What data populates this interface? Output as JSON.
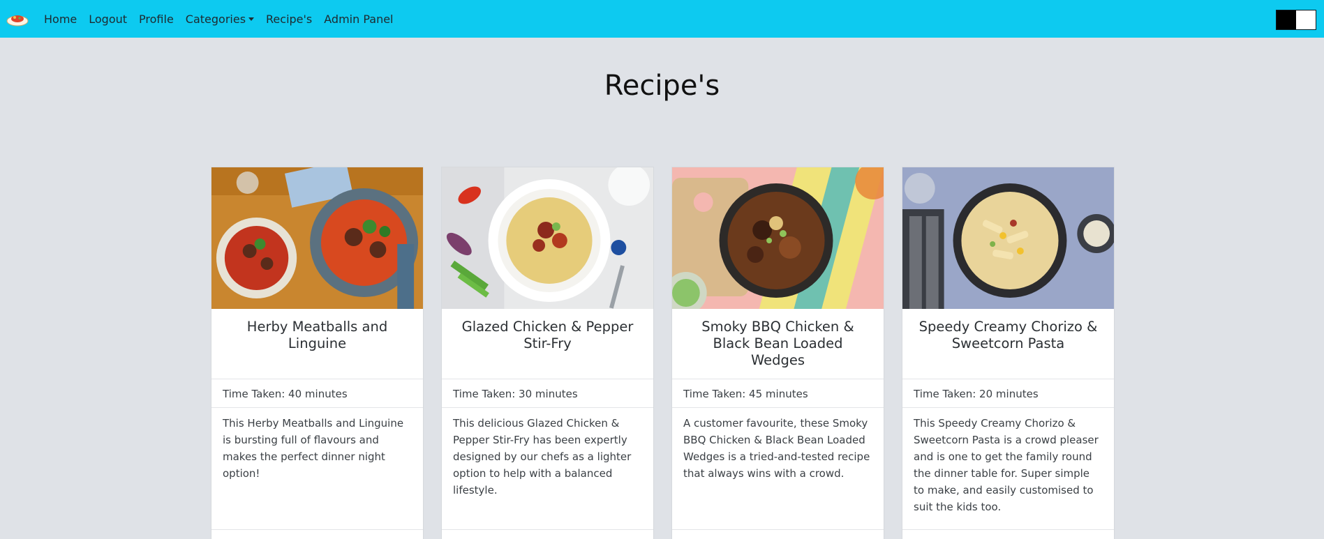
{
  "nav": {
    "brand_icon": "food-bowl-logo-icon",
    "items": [
      {
        "label": "Home"
      },
      {
        "label": "Logout"
      },
      {
        "label": "Profile"
      },
      {
        "label": "Categories"
      },
      {
        "label": "Recipe's"
      },
      {
        "label": "Admin Panel"
      }
    ],
    "bg_color": "#0dcaf0"
  },
  "page": {
    "title": "Recipe's",
    "bg_color": "#dfe2e7"
  },
  "recipes": [
    {
      "title": "Herby Meatballs and Linguine",
      "time": "Time Taken: 40 minutes",
      "description": "This Herby Meatballs and Linguine is bursting full of flavours and makes the perfect dinner night option!"
    },
    {
      "title": "Glazed Chicken & Pepper Stir-Fry",
      "time": "Time Taken: 30 minutes",
      "description": "This delicious Glazed Chicken & Pepper Stir-Fry has been expertly designed by our chefs as a lighter option to help with a balanced lifestyle."
    },
    {
      "title": "Smoky BBQ Chicken & Black Bean Loaded Wedges",
      "time": "Time Taken: 45 minutes",
      "description": "A customer favourite, these Smoky BBQ Chicken & Black Bean Loaded Wedges is a tried-and-tested recipe that always wins with a crowd."
    },
    {
      "title": "Speedy Creamy Chorizo & Sweetcorn Pasta",
      "time": "Time Taken: 20 minutes",
      "description": "This Speedy Creamy Chorizo & Sweetcorn Pasta is a crowd pleaser and is one to get the family round the dinner table for. Super simple to make, and easily customised to suit the kids too."
    }
  ]
}
